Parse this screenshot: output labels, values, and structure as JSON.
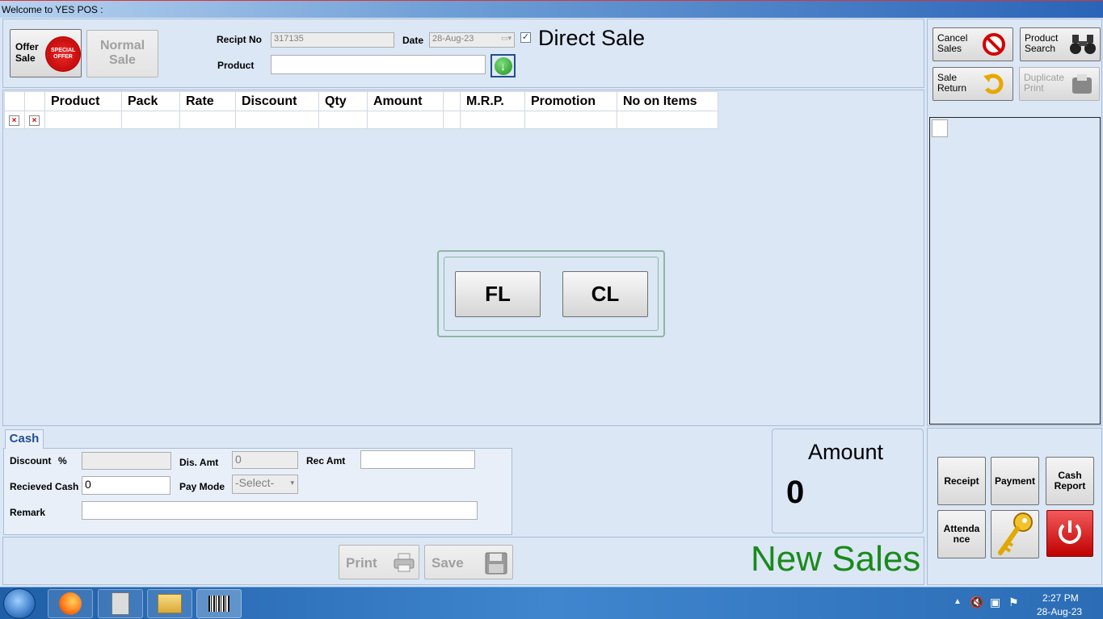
{
  "window": {
    "title": "Welcome to YES POS :"
  },
  "top": {
    "offer_sale_label": "Offer\nSale",
    "offer_badge": "SPECIAL OFFER",
    "normal_sale_label": "Normal\nSale",
    "receipt_no_label": "Recipt No",
    "receipt_no_value": "317135",
    "date_label": "Date",
    "date_value": "28-Aug-23",
    "direct_sale_label": "Direct Sale",
    "product_label": "Product",
    "product_value": ""
  },
  "grid": {
    "columns": [
      "Product",
      "Pack",
      "Rate",
      "Discount",
      "Qty",
      "Amount",
      "",
      "M.R.P.",
      "Promotion",
      "No on Items"
    ]
  },
  "dialog": {
    "fl_label": "FL",
    "cl_label": "CL"
  },
  "cash": {
    "tab_label": "Cash",
    "discount_label": "Discount",
    "percent_label": "%",
    "discount_value": "",
    "dis_amt_label": "Dis. Amt",
    "dis_amt_value": "0",
    "rec_amt_label": "Rec Amt",
    "rec_amt_value": "",
    "received_cash_label": "Recieved Cash",
    "received_cash_value": "0",
    "pay_mode_label": "Pay Mode",
    "pay_mode_value": "-Select-",
    "remark_label": "Remark",
    "remark_value": ""
  },
  "amount": {
    "label": "Amount",
    "value": "0"
  },
  "footer": {
    "print_label": "Print",
    "save_label": "Save",
    "status": "New Sales",
    "status_color": "#1a8a1a"
  },
  "right": {
    "cancel_sales": "Cancel\nSales",
    "product_search": "Product\nSearch",
    "sale_return": "Sale\nReturn",
    "duplicate_print": "Duplicate\nPrint",
    "receipt": "Receipt",
    "payment": "Payment",
    "cash_report": "Cash\nReport",
    "attendance": "Attenda\nnce"
  },
  "taskbar": {
    "time": "2:27 PM",
    "date": "28-Aug-23"
  }
}
